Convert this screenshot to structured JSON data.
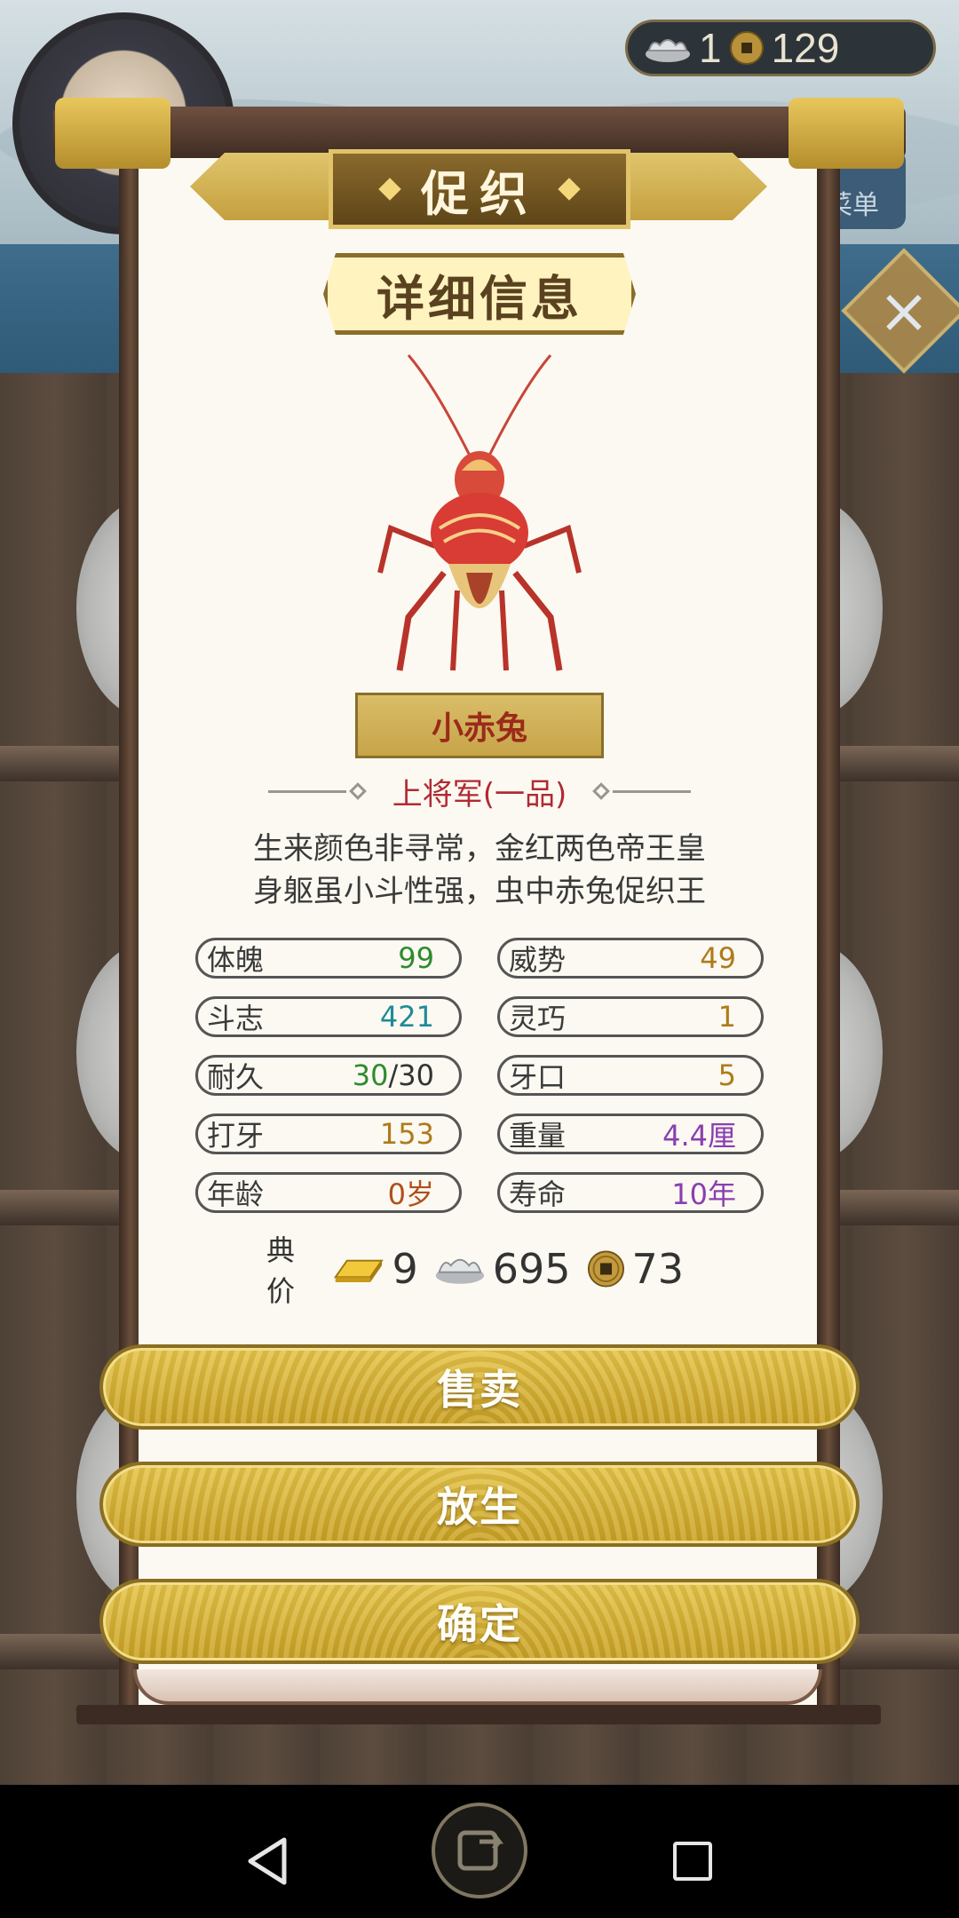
{
  "hud": {
    "ingot_count": "1",
    "coin_count": "129",
    "menu_label": "菜单",
    "close_icon": "×"
  },
  "panel": {
    "title": "促织",
    "subtitle": "详细信息"
  },
  "cricket": {
    "name": "小赤兔",
    "rank": "上将军(一品)",
    "poem": [
      "生来颜色非寻常，金红两色帝王皇",
      "身躯虽小斗性强，虫中赤兔促织王"
    ]
  },
  "stats": [
    {
      "label": "体魄",
      "value": "99",
      "color": "#2e8b2e"
    },
    {
      "label": "威势",
      "value": "49",
      "color": "#b07a1a"
    },
    {
      "label": "斗志",
      "value": "421",
      "color": "#1f8a9a"
    },
    {
      "label": "灵巧",
      "value": "1",
      "color": "#b07a1a"
    },
    {
      "label": "耐久",
      "value": "30",
      "value_suffix": "/30",
      "color": "#2e8b2e"
    },
    {
      "label": "牙口",
      "value": "5",
      "color": "#b07a1a"
    },
    {
      "label": "打牙",
      "value": "153",
      "color": "#b07a1a"
    },
    {
      "label": "重量",
      "value": "4.4厘",
      "color": "#8a3fb0"
    },
    {
      "label": "年龄",
      "value": "0岁",
      "color": "#b0501a"
    },
    {
      "label": "寿命",
      "value": "10年",
      "color": "#8a3fb0"
    }
  ],
  "price": {
    "label": "典价",
    "gold": "9",
    "silver": "695",
    "copper": "73",
    "icons": [
      "gold-bar-icon",
      "silver-ingot-icon",
      "copper-coin-icon"
    ]
  },
  "actions": {
    "sell": "售卖",
    "release": "放生",
    "confirm": "确定"
  },
  "colors": {
    "paper": "#fbf9f1",
    "button_gold": "#d9b53a",
    "rank_red": "#b02a34",
    "name_red": "#9a2a1a"
  }
}
